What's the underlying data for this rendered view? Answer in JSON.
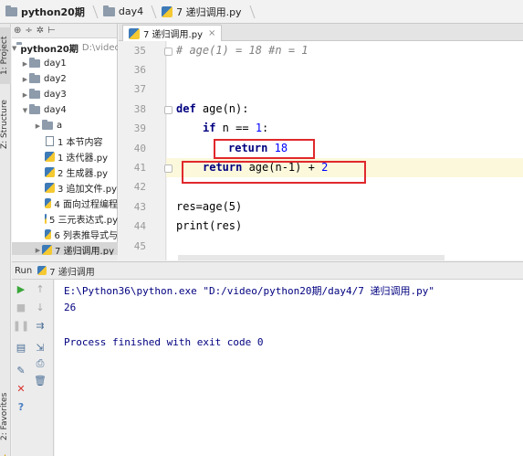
{
  "breadcrumb": {
    "project": "python20期",
    "folder": "day4",
    "file": "7 递归调用.py"
  },
  "left_strip": {
    "project_tab": "1: Project",
    "structure_tab": "Z: Structure",
    "favorites_tab": "2: Favorites"
  },
  "project_tree": {
    "toolbar_icons": [
      "sync-icon",
      "settings-icon",
      "collapse-icon"
    ],
    "root": {
      "name": "python20期",
      "path": "D:\\video"
    },
    "items": [
      {
        "label": "day1",
        "kind": "folder",
        "expanded": false
      },
      {
        "label": "day2",
        "kind": "folder",
        "expanded": false
      },
      {
        "label": "day3",
        "kind": "folder",
        "expanded": false
      },
      {
        "label": "day4",
        "kind": "folder",
        "expanded": true
      },
      {
        "label": "a",
        "kind": "folder",
        "expanded": false
      },
      {
        "label": "1 本节内容",
        "kind": "text"
      },
      {
        "label": "1 迭代器.py",
        "kind": "python"
      },
      {
        "label": "2 生成器.py",
        "kind": "python"
      },
      {
        "label": "3 追加文件.py",
        "kind": "python"
      },
      {
        "label": "4 面向过程编程",
        "kind": "python"
      },
      {
        "label": "5 三元表达式.py",
        "kind": "python"
      },
      {
        "label": "6 列表推导式与",
        "kind": "python"
      },
      {
        "label": "7 递归调用.py",
        "kind": "python",
        "selected": true
      }
    ]
  },
  "editor": {
    "tab_label": "7 递归调用.py",
    "lines": [
      {
        "number": "35",
        "text": "# age(1) = 18 #n = 1"
      },
      {
        "number": "36",
        "text": ""
      },
      {
        "number": "37",
        "text": ""
      },
      {
        "number": "38",
        "text": "def age(n):"
      },
      {
        "number": "39",
        "text": "    if n == 1:"
      },
      {
        "number": "40",
        "text": "        return 18"
      },
      {
        "number": "41",
        "text": "    return age(n-1) + 2"
      },
      {
        "number": "42",
        "text": ""
      },
      {
        "number": "43",
        "text": "res=age(5)"
      },
      {
        "number": "44",
        "text": "print(res)"
      },
      {
        "number": "45",
        "text": ""
      }
    ],
    "code": {
      "comment": "# age(1) = 18 #n = 1",
      "def_kw": "def",
      "def_rest": " age(n):",
      "if_kw": "if",
      "if_rest": " n == ",
      "if_num": "1",
      "if_colon": ":",
      "ret1_kw": "return",
      "ret1_num": "18",
      "ret2_kw": "return",
      "ret2_rest": " age(n-1) + ",
      "ret2_num": "2",
      "res_line": "res=age(5)",
      "print_line": "print(res)"
    },
    "highlight_color": "#e0282c"
  },
  "run": {
    "label": "Run",
    "config": "7 递归调用",
    "console": [
      "E:\\Python36\\python.exe \"D:/video/python20期/day4/7 递归调用.py\"",
      "26",
      "",
      "Process finished with exit code 0"
    ]
  }
}
